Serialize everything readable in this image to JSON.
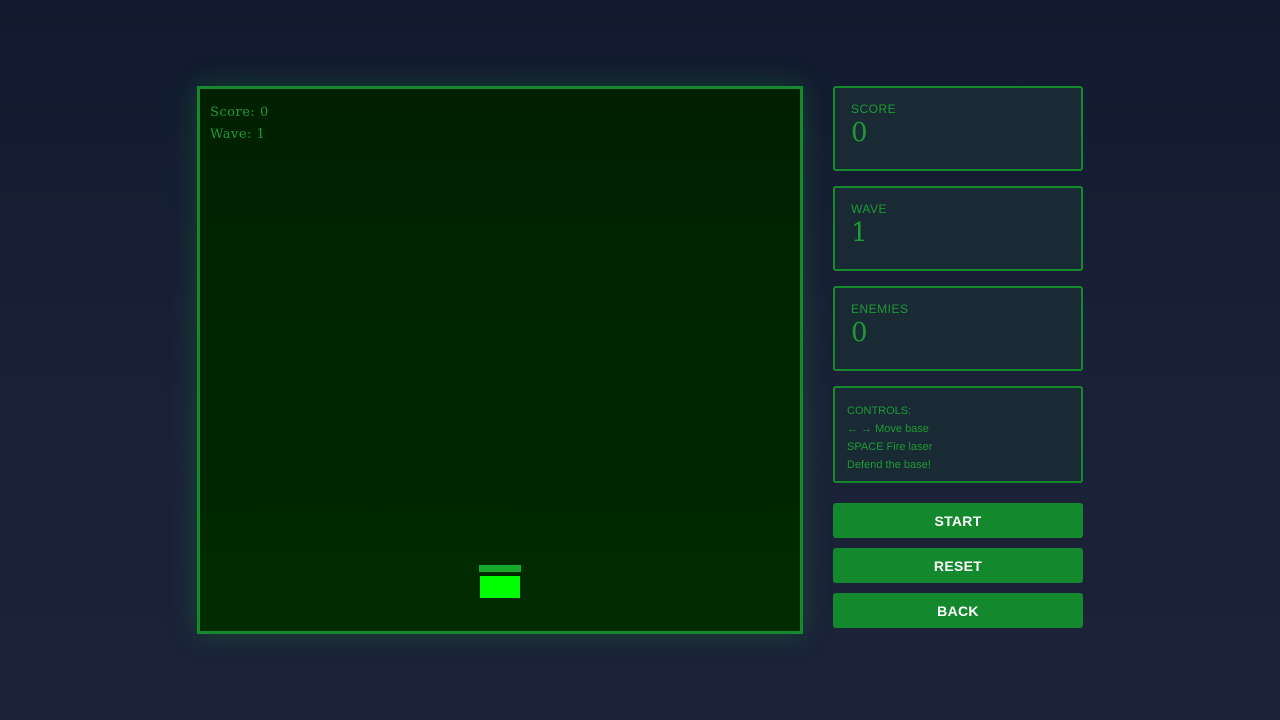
{
  "game": {
    "hud": {
      "score_label": "Score",
      "score_value": "0",
      "wave_label": "Wave",
      "wave_value": "1"
    }
  },
  "stats": {
    "score": {
      "label": "SCORE",
      "value": "0"
    },
    "wave": {
      "label": "WAVE",
      "value": "1"
    },
    "enemies": {
      "label": "ENEMIES",
      "value": "0"
    }
  },
  "controls": {
    "title": "CONTROLS:",
    "lines": [
      "← → Move base",
      "SPACE Fire laser",
      "Defend the base!"
    ]
  },
  "buttons": {
    "start": "START",
    "reset": "RESET",
    "back": "BACK"
  },
  "colors": {
    "accent": "#148a2c",
    "player": "#00ff00",
    "canvas_bg": "#002200",
    "button_bg": "#13882c"
  }
}
